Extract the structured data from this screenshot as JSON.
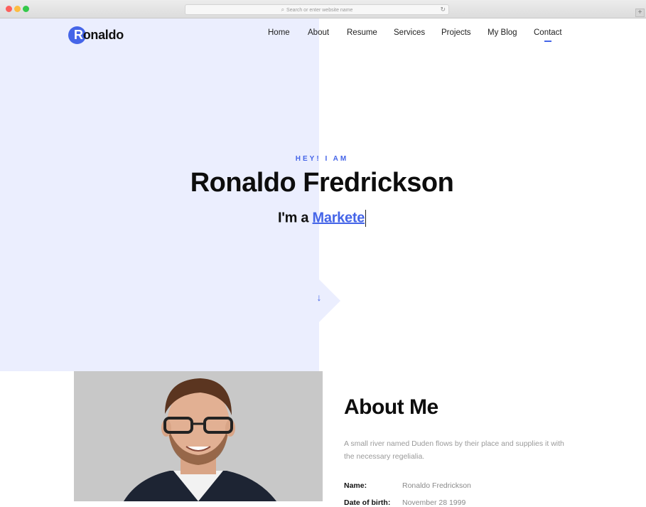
{
  "browser": {
    "address_placeholder": "Search or enter website name",
    "new_tab_label": "+"
  },
  "site": {
    "logo_initial": "R",
    "logo_rest": "onaldo",
    "brand_color": "#4565e8",
    "hero_bg_color": "#ebeefe"
  },
  "nav": {
    "items": [
      "Home",
      "About",
      "Resume",
      "Services",
      "Projects",
      "My Blog",
      "Contact"
    ],
    "active": "Contact"
  },
  "hero": {
    "greeting": "HEY! I AM",
    "name": "Ronaldo Fredrickson",
    "role_prefix": "I'm a",
    "role_typed": "Markete"
  },
  "about": {
    "title": "About Me",
    "description": "A small river named Duden flows by their place and supplies it with the necessary regelialia.",
    "info": [
      {
        "label": "Name:",
        "value": "Ronaldo Fredrickson"
      },
      {
        "label": "Date of birth:",
        "value": "November 28 1999"
      }
    ]
  }
}
